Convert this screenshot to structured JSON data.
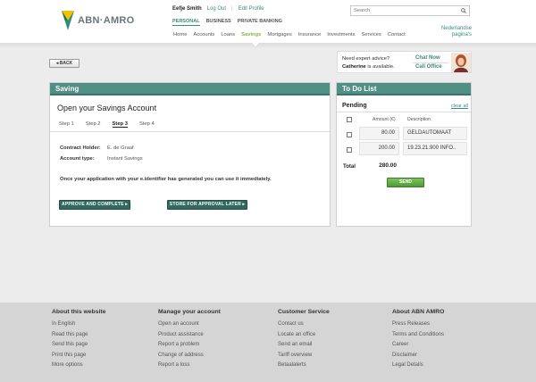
{
  "header": {
    "brand": "ABN·AMRO",
    "user_name": "Eefje Smith",
    "logout": "Log Out",
    "separator": "|",
    "edit_profile": "Edit Profile",
    "segments": [
      "PERSONAL",
      "BUSINESS",
      "PRIVATE BANKING"
    ],
    "nav": [
      "Home",
      "Accounts",
      "Loans",
      "Savings",
      "Mortgages",
      "Insurance",
      "Investments",
      "Services",
      "Contact"
    ],
    "search_placeholder": "Search",
    "lang_line1": "Nederlandse",
    "lang_line2": "pagina's"
  },
  "back_label": "◂ BACK",
  "expert": {
    "question": "Need expert advice?",
    "name": "Catherine",
    "status": " is available.",
    "chat": "Chat Now",
    "office": "Call Office"
  },
  "saving": {
    "header": "Saving",
    "title": "Open your Savings Account",
    "steps": [
      "Step 1",
      "Step 2",
      "Step 3",
      "Step 4"
    ],
    "current_step": 2,
    "holder_label": "Contract Holder:",
    "holder_value": "E. de Graaf",
    "type_label": "Account type:",
    "type_value": "Instant Savings",
    "info": "Once your application with your e.identifier has generated you can use it immediately.",
    "approve_button": "APPROVE AND COMPLETE ▸",
    "or": "or",
    "store_button": "STORE FOR APPROVAL LATER ▸"
  },
  "todo": {
    "header": "To Do List",
    "pending": "Pending",
    "clear": "clear all",
    "col_amount": "Amount  (€)",
    "col_desc": "Description",
    "rows": [
      {
        "amount": "80.00",
        "desc": "GELDAUTOMAAT"
      },
      {
        "amount": "200.00",
        "desc": "19.23.21.900 INFO.."
      }
    ],
    "total_label": "Total",
    "total_value": "280.00",
    "send": "SEND"
  },
  "footer": {
    "cols": [
      {
        "title": "About this website",
        "items": [
          "In English",
          "Read this page",
          "Send this page",
          "Print this page",
          "More options"
        ]
      },
      {
        "title": "Manage your account",
        "items": [
          "Open an account",
          "Product assistance",
          "Report a problem",
          "Change of address",
          "Report a loss"
        ]
      },
      {
        "title": "Customer Service",
        "items": [
          "Contact us",
          "Locate an office",
          "Send an email",
          "Tariff overview",
          "Betaalalerts"
        ]
      },
      {
        "title": "About ABN AMRO",
        "items": [
          "Press Releases",
          "Terms and Conditions",
          "Career",
          "Disclaimer",
          "Legal Details"
        ]
      }
    ]
  },
  "colors": {
    "brand_green": "#3b8a7e",
    "panel_header": "#4f8f84",
    "savings_nav": "#8ab43f",
    "send_green": "#4f9a38"
  }
}
